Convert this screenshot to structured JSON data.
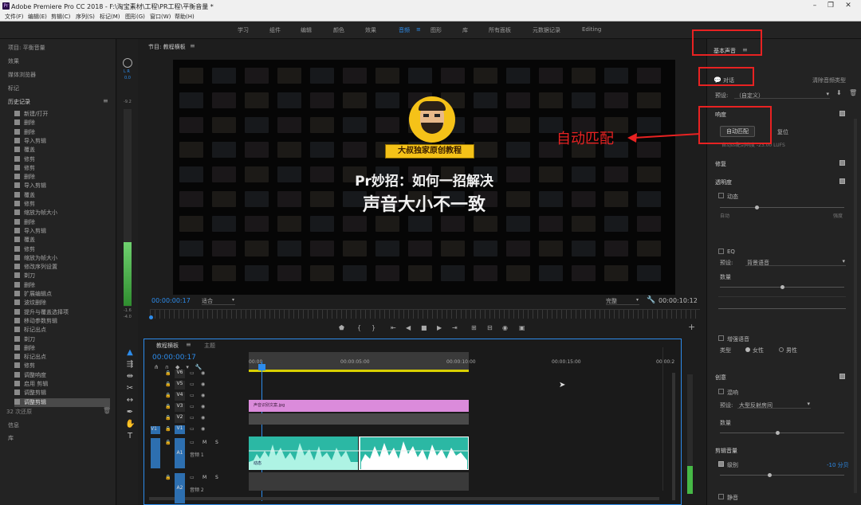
{
  "window": {
    "title": "Adobe Premiere Pro CC 2018 - F:\\淘宝素材\\工程\\PR工程\\平衡音量 *",
    "app_icon": "Pr"
  },
  "menu": [
    "文件(F)",
    "编辑(E)",
    "剪辑(C)",
    "序列(S)",
    "标记(M)",
    "图形(G)",
    "窗口(W)",
    "帮助(H)"
  ],
  "workspaces": [
    {
      "label": "学习",
      "active": false
    },
    {
      "label": "组件",
      "active": false
    },
    {
      "label": "编辑",
      "active": false
    },
    {
      "label": "颜色",
      "active": false
    },
    {
      "label": "效果",
      "active": false
    },
    {
      "label": "音频",
      "active": true
    },
    {
      "label": "≡",
      "active": true
    },
    {
      "label": "图形",
      "active": false
    },
    {
      "label": "库",
      "active": false
    },
    {
      "label": "所有面板",
      "active": false
    },
    {
      "label": "元数据记录",
      "active": false
    },
    {
      "label": "Editing",
      "active": false
    }
  ],
  "left_panel": {
    "tabs": [
      "项目: 平衡音量",
      "效果",
      "媒体浏览器",
      "标记"
    ],
    "history_title": "历史记录",
    "history_items": [
      "新建/打开",
      "删除",
      "删除",
      "导入剪辑",
      "覆盖",
      "修剪",
      "修剪",
      "删除",
      "导入剪辑",
      "覆盖",
      "修剪",
      "缩放为帧大小",
      "删除",
      "导入剪辑",
      "覆盖",
      "修剪",
      "缩放为帧大小",
      "修改序列设置",
      "剃刀",
      "删除",
      "扩展编辑点",
      "波纹删除",
      "提升与覆盖选择项",
      "移动参数剪辑",
      "标记出点",
      "剃刀",
      "删除",
      "标记出点",
      "修剪",
      "调整响度",
      "启用 剪辑",
      "调整剪辑",
      "调整剪辑"
    ],
    "undo_count": "32 次还原",
    "tabs_bottom": [
      "信息",
      "库"
    ]
  },
  "audio_meter": {
    "top_label": "L R",
    "db0": "0.0",
    "dbs": [
      "-9.2",
      "-1.6",
      "-4.0"
    ]
  },
  "program_monitor": {
    "tab": "节目: 教程横板",
    "badge_text": "大叔独家原创教程",
    "headline1": "Pr妙招：如何一招解决",
    "headline2": "声音大小不一致",
    "timecode_left": "00:00:00:17",
    "fit": "适合",
    "quality": "完整",
    "timecode_right": "00:00:10:12"
  },
  "annotation": {
    "text": "自动匹配",
    "color": "#e82222"
  },
  "timeline": {
    "tabs": [
      "教程横板",
      "主题"
    ],
    "timecode": "00:00:00:17",
    "ruler": [
      "00:00",
      "00:00:05:00",
      "00:00:10:00",
      "00:00:15:00",
      "00:00:2"
    ],
    "video_tracks": [
      "V6",
      "V5",
      "V4",
      "V3",
      "V2",
      "V1"
    ],
    "audio_tracks": [
      {
        "id": "A1",
        "name": "音频 1"
      },
      {
        "id": "A2",
        "name": "音频 2"
      }
    ],
    "clip_v2_label": "声音识别文案.jpg",
    "audio_clip_label": "动态"
  },
  "right_panel": {
    "title": "基本声音",
    "clip_type": "对话",
    "clear_btn": "清除音频类型",
    "preset_label": "预设:",
    "preset_value": "（自定义）",
    "loudness": "响度",
    "auto_match": "自动匹配",
    "reset": "复位",
    "loudness_note": "自动匹配到响度 -23.00 LUFS",
    "repair": "修复",
    "clarity": "透明度",
    "dynamics": "动态",
    "dynamics_low": "自动",
    "dynamics_high": "强度",
    "eq": "EQ",
    "eq_preset_label": "预设:",
    "eq_preset": "背景语音",
    "amount": "数量",
    "enhance": "增强语音",
    "type_label": "类型",
    "female": "女性",
    "male": "男性",
    "creative": "创意",
    "reverb": "混响",
    "reverb_preset_label": "预设:",
    "reverb_preset": "大型反射房间",
    "amount2": "数量",
    "clip_volume": "剪辑音量",
    "level": "级别",
    "level_value": "-10 分贝",
    "mute": "静音"
  }
}
